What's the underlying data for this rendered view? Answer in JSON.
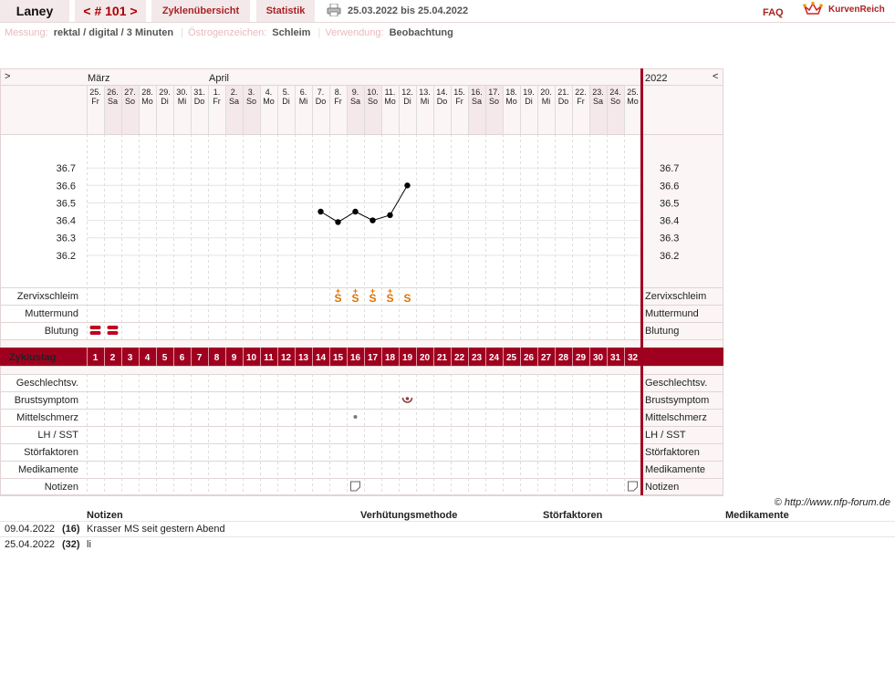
{
  "header": {
    "user": "Laney",
    "cycle_nav": "< # 101 >",
    "tab_overview": "Zyklenübersicht",
    "tab_stats": "Statistik",
    "date_range": "25.03.2022 bis 25.04.2022",
    "faq": "FAQ",
    "brand": "KurvenReich"
  },
  "info": {
    "messung_label": "Messung:",
    "messung_value": "rektal / digital / 3 Minuten",
    "oestrogen_label": "Östrogenzeichen:",
    "oestrogen_value": "Schleim",
    "verwendung_label": "Verwendung:",
    "verwendung_value": "Beobachtung"
  },
  "chart_data": {
    "type": "line",
    "nav_left": ">",
    "nav_right": "<",
    "year": "2022",
    "months": [
      {
        "label": "März",
        "col": 0
      },
      {
        "label": "April",
        "col": 7
      }
    ],
    "dates": [
      "25.",
      "26.",
      "27.",
      "28.",
      "29.",
      "30.",
      "31.",
      "1.",
      "2.",
      "3.",
      "4.",
      "5.",
      "6.",
      "7.",
      "8.",
      "9.",
      "10.",
      "11.",
      "12.",
      "13.",
      "14.",
      "15.",
      "16.",
      "17.",
      "18.",
      "19.",
      "20.",
      "21.",
      "22.",
      "23.",
      "24.",
      "25."
    ],
    "weekdays": [
      "Fr",
      "Sa",
      "So",
      "Mo",
      "Di",
      "Mi",
      "Do",
      "Fr",
      "Sa",
      "So",
      "Mo",
      "Di",
      "Mi",
      "Do",
      "Fr",
      "Sa",
      "So",
      "Mo",
      "Di",
      "Mi",
      "Do",
      "Fr",
      "Sa",
      "So",
      "Mo",
      "Di",
      "Mi",
      "Do",
      "Fr",
      "Sa",
      "So",
      "Mo"
    ],
    "cycle_days": [
      "1",
      "2",
      "3",
      "4",
      "5",
      "6",
      "7",
      "8",
      "9",
      "10",
      "11",
      "12",
      "13",
      "14",
      "15",
      "16",
      "17",
      "18",
      "19",
      "20",
      "21",
      "22",
      "23",
      "24",
      "25",
      "26",
      "27",
      "28",
      "29",
      "30",
      "31",
      "32"
    ],
    "y_ticks": [
      "36.7",
      "36.6",
      "36.5",
      "36.4",
      "36.3",
      "36.2"
    ],
    "ylim": [
      36.1,
      36.8
    ],
    "temperature": [
      {
        "day": 14,
        "value": 36.45
      },
      {
        "day": 15,
        "value": 36.39
      },
      {
        "day": 16,
        "value": 36.45
      },
      {
        "day": 17,
        "value": 36.4
      },
      {
        "day": 18,
        "value": 36.43
      },
      {
        "day": 19,
        "value": 36.6
      }
    ],
    "rows": {
      "zervix": "Zervixschleim",
      "muttermund": "Muttermund",
      "blutung": "Blutung",
      "zyklustag": "Zyklustag",
      "geschlecht": "Geschlechtsv.",
      "brust": "Brustsymptom",
      "mittel": "Mittelschmerz",
      "lh": "LH / SST",
      "stoer": "Störfaktoren",
      "medi": "Medikamente",
      "notizen": "Notizen"
    },
    "zervix_marks": [
      {
        "day": 15,
        "symbol": "S+"
      },
      {
        "day": 16,
        "symbol": "S+"
      },
      {
        "day": 17,
        "symbol": "S+"
      },
      {
        "day": 18,
        "symbol": "S+"
      },
      {
        "day": 19,
        "symbol": "S"
      }
    ],
    "zervix_glyph": "S",
    "zervix_plus": "+",
    "blutung_days": [
      1,
      2
    ],
    "brust_days": [
      19
    ],
    "mittel_days": [
      16
    ],
    "notiz_days": [
      16,
      32
    ],
    "colors": {
      "accent": "#a00020",
      "zervix": "#e07000",
      "muttermund": "#4455bb",
      "weekend": "#f5e8ea"
    }
  },
  "copyright": "© http://www.nfp-forum.de",
  "notes": {
    "headers": [
      "Notizen",
      "Verhütungsmethode",
      "Störfaktoren",
      "Medikamente"
    ],
    "rows": [
      {
        "date": "09.04.2022",
        "day": "(16)",
        "text": "Krasser MS seit gestern Abend"
      },
      {
        "date": "25.04.2022",
        "day": "(32)",
        "text": "li"
      }
    ]
  }
}
